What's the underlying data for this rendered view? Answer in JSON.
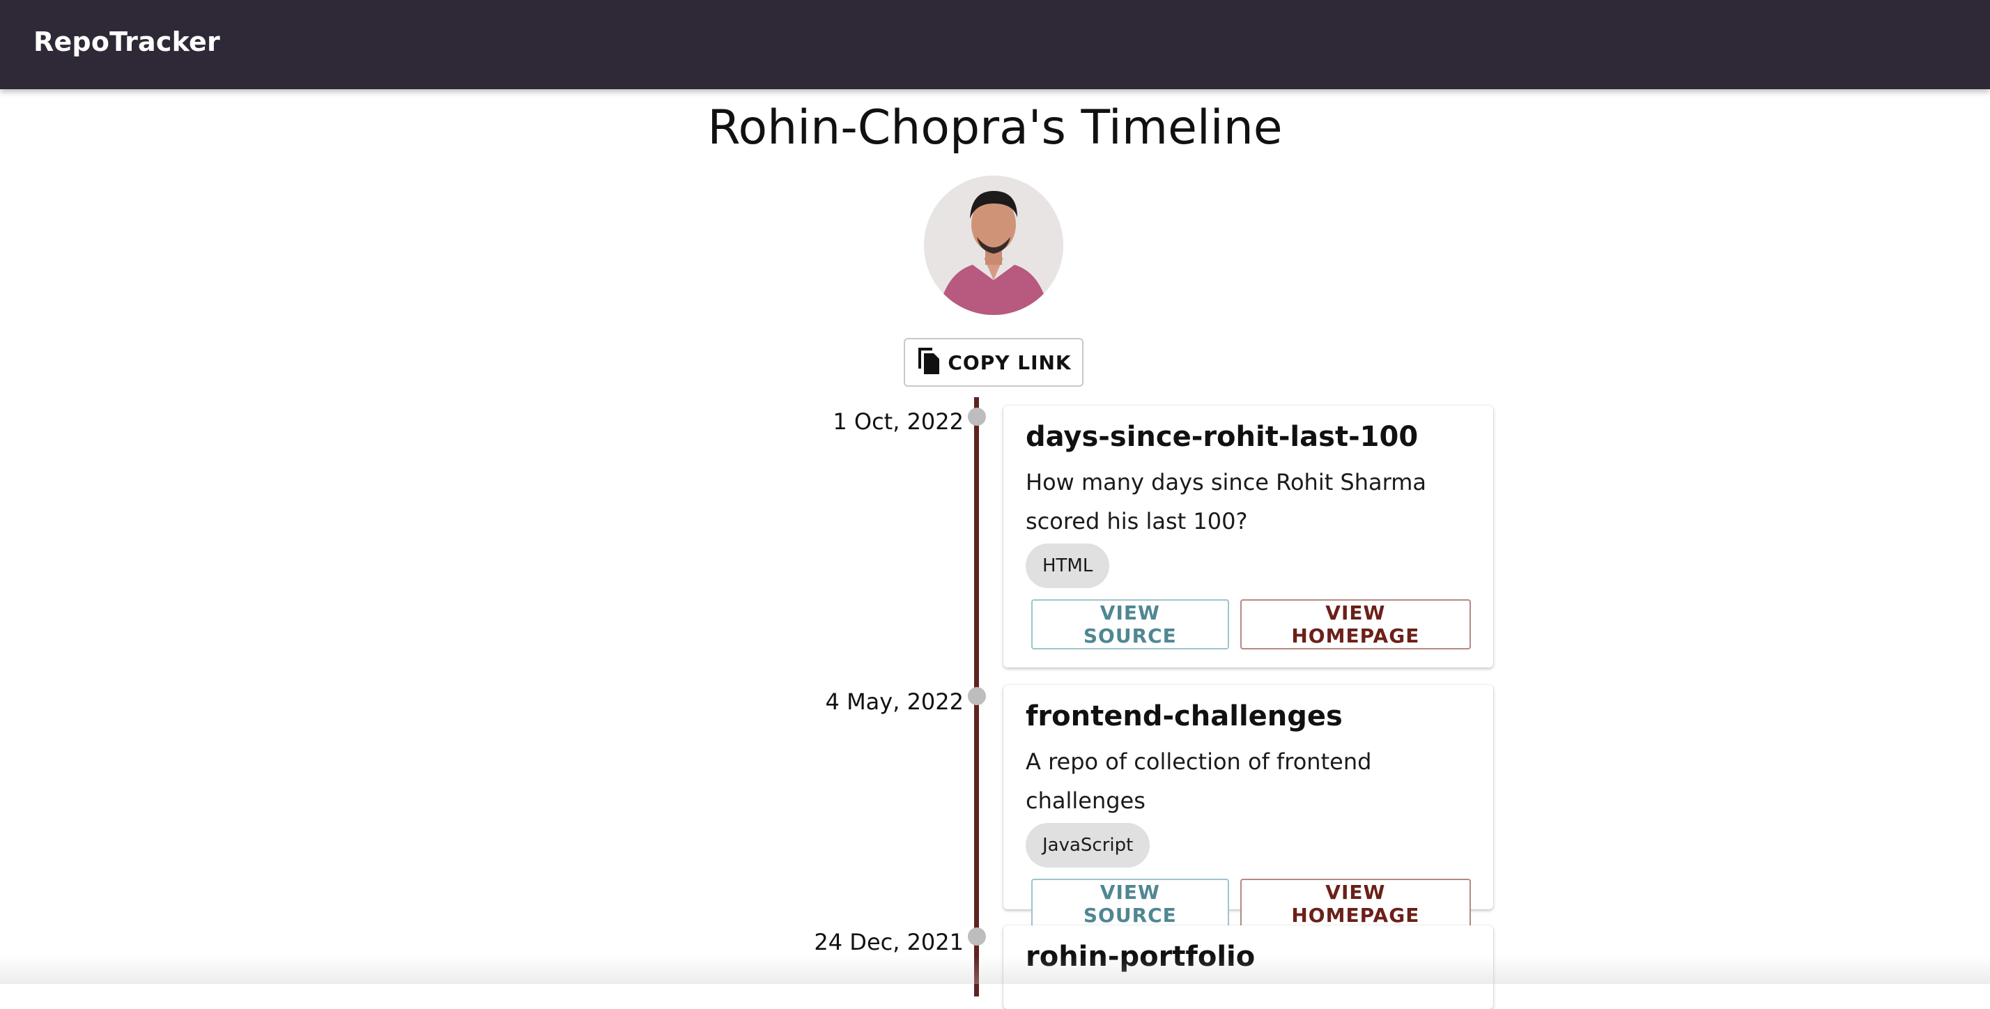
{
  "app": {
    "title": "RepoTracker"
  },
  "page": {
    "title": "Rohin-Chopra's Timeline",
    "copy_button": "COPY LINK"
  },
  "timeline": [
    {
      "date": "1 Oct, 2022",
      "name": "days-since-rohit-last-100",
      "description": "How many days since Rohit Sharma scored his last 100?",
      "language": "HTML",
      "view_source": "VIEW SOURCE",
      "view_homepage": "VIEW HOMEPAGE"
    },
    {
      "date": "4 May, 2022",
      "name": "frontend-challenges",
      "description": "A repo of collection of frontend challenges",
      "language": "JavaScript",
      "view_source": "VIEW SOURCE",
      "view_homepage": "VIEW HOMEPAGE"
    },
    {
      "date": "24 Dec, 2021",
      "name": "rohin-portfolio"
    }
  ],
  "colors": {
    "appbar": "#2f2836",
    "timeline_line": "#5e2320",
    "source_button": "#4f8792",
    "homepage_button": "#6b2019"
  },
  "icons": {
    "copy": "copy-icon"
  }
}
